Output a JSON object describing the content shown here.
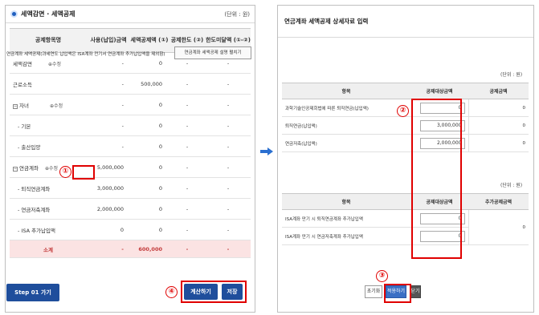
{
  "left": {
    "title": "세액감면 · 세액공제",
    "unit": "(단위 : 원)",
    "columns": [
      "공제항목명",
      "사용(납입)금액",
      "세액공제액 (①)",
      "공제한도 (②)",
      "한도미달액 (①-②)"
    ],
    "rows": [
      {
        "name": "세액감면",
        "mod": "⊕수정",
        "used": "-",
        "credit": "0",
        "limit": "-",
        "short": "-"
      },
      {
        "name": "근로소득",
        "mod": "",
        "used": "-",
        "credit": "500,000",
        "limit": "-",
        "short": "-"
      },
      {
        "name": "자녀",
        "mod": "⊕수정",
        "used": "-",
        "credit": "0",
        "limit": "-",
        "short": "-"
      },
      {
        "name": "- 기본",
        "mod": "",
        "used": "-",
        "credit": "0",
        "limit": "-",
        "short": "-"
      },
      {
        "name": "- 출산입양",
        "mod": "",
        "used": "-",
        "credit": "0",
        "limit": "-",
        "short": "-"
      },
      {
        "name": "연금계좌",
        "mod": "⊕수정",
        "used": "5,000,000",
        "credit": "0",
        "limit": "-",
        "short": "-"
      },
      {
        "name": "- 퇴직연금계좌",
        "mod": "",
        "used": "3,000,000",
        "credit": "0",
        "limit": "-",
        "short": "-"
      },
      {
        "name": "- 연금저축계좌",
        "mod": "",
        "used": "2,000,000",
        "credit": "0",
        "limit": "-",
        "short": "-"
      },
      {
        "name": "- ISA 추가납입액",
        "mod": "",
        "used": "0",
        "credit": "0",
        "limit": "-",
        "short": "-"
      }
    ],
    "subtotal": {
      "label": "소계",
      "used": "-",
      "credit": "600,000",
      "limit": "-",
      "short": "-"
    },
    "step_button": "Step 01 가기",
    "calc_button": "계산하기",
    "save_button": "저장"
  },
  "markers": {
    "m1": "①",
    "m2": "②",
    "m3": "③",
    "m4": "④"
  },
  "right": {
    "title": "연금계좌 세액공제 상세자료 입력",
    "desc": "연금계좌 세액공제(과세연도 납입액은 ISA계좌 전기서 연금계좌 추가납입액을 제외함)",
    "guide_button": "연금계좌 세액공제 설명 펼치기",
    "unit1": "(단위 : 원)",
    "unit2": "(단위 : 원)",
    "t1_cols": [
      "항목",
      "공제대상금액",
      "공제금액"
    ],
    "t1_rows": [
      {
        "label": "과학기술인공제회법에 따른 퇴직연금(납입액)",
        "value": "0",
        "deduct": "0"
      },
      {
        "label": "퇴직연금(납입액)",
        "value": "3,000,000",
        "deduct": "0"
      },
      {
        "label": "연금저축(납입액)",
        "value": "2,000,000",
        "deduct": "0"
      }
    ],
    "t2_cols": [
      "항목",
      "공제대상금액",
      "추가공제금액"
    ],
    "t2_rows": [
      {
        "label": "ISA계좌 만기 시 퇴직연금계좌 추가납입액",
        "value": "0"
      },
      {
        "label": "ISA계좌 만기 시 연금저축계좌 추가납입액",
        "value": "0"
      }
    ],
    "t2_deduct": "0",
    "reset_button": "초기화",
    "apply_button": "적용하기",
    "close_button": "닫기"
  },
  "colors": {
    "accent": "#1f4e9c",
    "annotation": "#e00000",
    "subtotal_bg": "#fbe3e3"
  }
}
